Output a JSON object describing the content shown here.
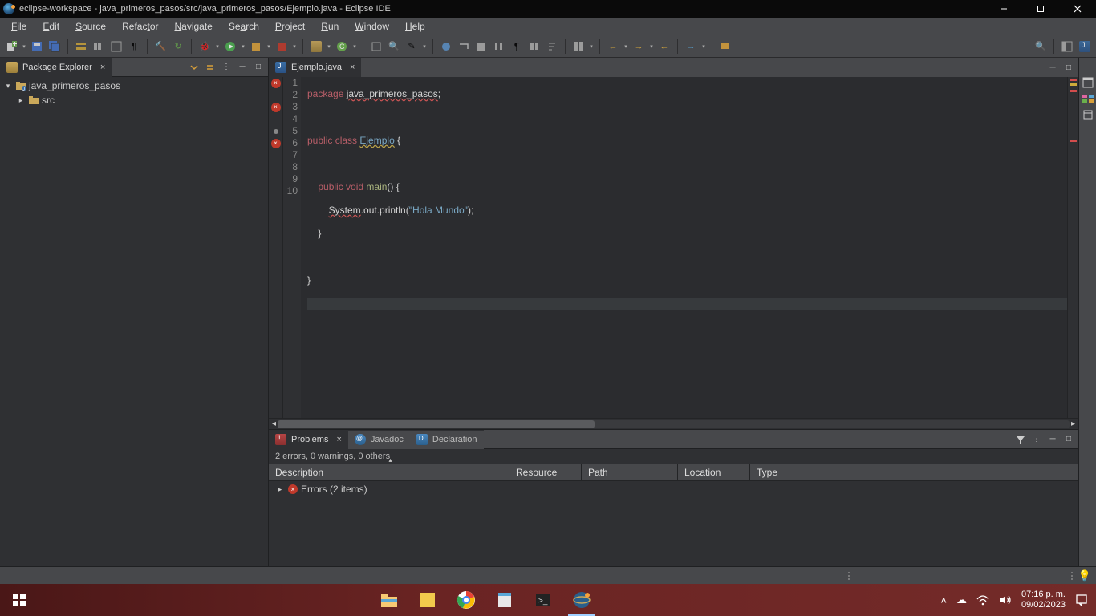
{
  "titlebar": {
    "title": "eclipse-workspace - java_primeros_pasos/src/java_primeros_pasos/Ejemplo.java - Eclipse IDE"
  },
  "menu": {
    "items": [
      "File",
      "Edit",
      "Source",
      "Refactor",
      "Navigate",
      "Search",
      "Project",
      "Run",
      "Window",
      "Help"
    ]
  },
  "package_explorer": {
    "title": "Package Explorer",
    "project": "java_primeros_pasos",
    "src": "src"
  },
  "editor": {
    "tab": "Ejemplo.java",
    "lines": [
      "1",
      "2",
      "3",
      "4",
      "5",
      "6",
      "7",
      "8",
      "9",
      "10"
    ],
    "code": {
      "l1_kw": "package",
      "l1_pkg": "java_primeros_pasos",
      "l1_end": ";",
      "l3_pub": "public",
      "l3_cls": "class",
      "l3_name": "Ejemplo",
      "l3_brace": " {",
      "l5_pub": "public",
      "l5_void": "void",
      "l5_main": "main",
      "l5_paren": "() {",
      "l6_sys": "System",
      "l6_outpr": ".out.println(",
      "l6_str": "\"Hola Mundo\"",
      "l6_end": ");",
      "l7": "}",
      "l9": "}"
    }
  },
  "bottom": {
    "tabs": {
      "problems": "Problems",
      "javadoc": "Javadoc",
      "declaration": "Declaration"
    },
    "summary": "2 errors, 0 warnings, 0 others",
    "columns": {
      "desc": "Description",
      "resource": "Resource",
      "path": "Path",
      "location": "Location",
      "type": "Type"
    },
    "errors_node": "Errors (2 items)"
  },
  "taskbar": {
    "time": "07:16 p. m.",
    "date": "09/02/2023"
  }
}
